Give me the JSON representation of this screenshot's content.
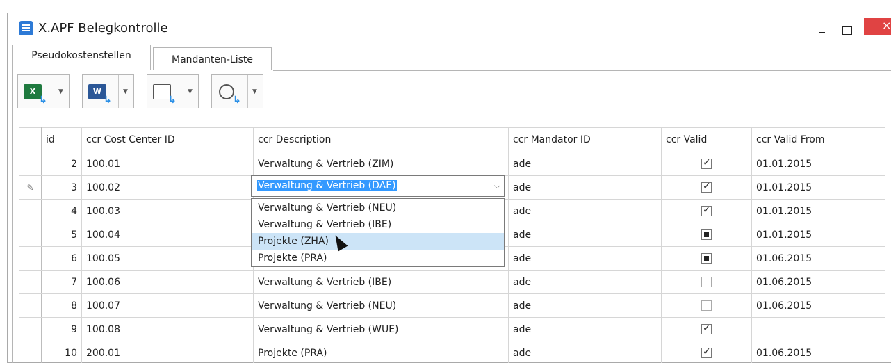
{
  "window": {
    "title": "X.APF Belegkontrolle",
    "icon": "app-icon",
    "close_glyph": "×"
  },
  "tabs": [
    {
      "label": "Pseudokostenstellen",
      "active": true
    },
    {
      "label": "Mandanten-Liste",
      "active": false
    }
  ],
  "toolbar": [
    {
      "icon": "excel-export-icon",
      "glyph": "X"
    },
    {
      "icon": "word-export-icon",
      "glyph": "W"
    },
    {
      "icon": "export-icon",
      "glyph": ""
    },
    {
      "icon": "web-export-icon",
      "glyph": ""
    }
  ],
  "grid": {
    "columns": [
      "id",
      "ccr Cost Center ID",
      "ccr Description",
      "ccr Mandator ID",
      "ccr Valid",
      "ccr Valid From"
    ],
    "rows": [
      {
        "id": "2",
        "cost_center": "100.01",
        "description": "Verwaltung & Vertrieb (ZIM)",
        "mandator": "ade",
        "valid": "checked",
        "valid_from": "01.01.2015"
      },
      {
        "id": "3",
        "cost_center": "100.02",
        "description": "Verwaltung & Vertrieb (DAE)",
        "mandator": "ade",
        "valid": "checked",
        "valid_from": "01.01.2015"
      },
      {
        "id": "4",
        "cost_center": "100.03",
        "description": "",
        "mandator": "ade",
        "valid": "checked",
        "valid_from": "01.01.2015"
      },
      {
        "id": "5",
        "cost_center": "100.04",
        "description": "",
        "mandator": "ade",
        "valid": "indeterminate",
        "valid_from": "01.01.2015"
      },
      {
        "id": "6",
        "cost_center": "100.05",
        "description": "",
        "mandator": "ade",
        "valid": "indeterminate",
        "valid_from": "01.06.2015"
      },
      {
        "id": "7",
        "cost_center": "100.06",
        "description": "Verwaltung & Vertrieb (IBE)",
        "mandator": "ade",
        "valid": "unchecked",
        "valid_from": "01.06.2015"
      },
      {
        "id": "8",
        "cost_center": "100.07",
        "description": "Verwaltung & Vertrieb (NEU)",
        "mandator": "ade",
        "valid": "unchecked",
        "valid_from": "01.06.2015"
      },
      {
        "id": "9",
        "cost_center": "100.08",
        "description": "Verwaltung & Vertrieb (WUE)",
        "mandator": "ade",
        "valid": "checked",
        "valid_from": ""
      },
      {
        "id": "10",
        "cost_center": "200.01",
        "description": "Projekte (PRA)",
        "mandator": "ade",
        "valid": "checked",
        "valid_from": "01.06.2015"
      }
    ]
  },
  "editor": {
    "value": "Verwaltung & Vertrieb (DAE)",
    "edit_row_indicator": "edit-pencil-icon"
  },
  "dropdown": {
    "items": [
      "Verwaltung & Vertrieb (NEU)",
      "Verwaltung & Vertrieb (IBE)",
      "Projekte (ZHA)",
      "Projekte (PRA)"
    ],
    "hovered_index": 2
  },
  "colors": {
    "close_button": "#e04343",
    "selection": "#3399ff",
    "hover": "#cce4f7"
  }
}
